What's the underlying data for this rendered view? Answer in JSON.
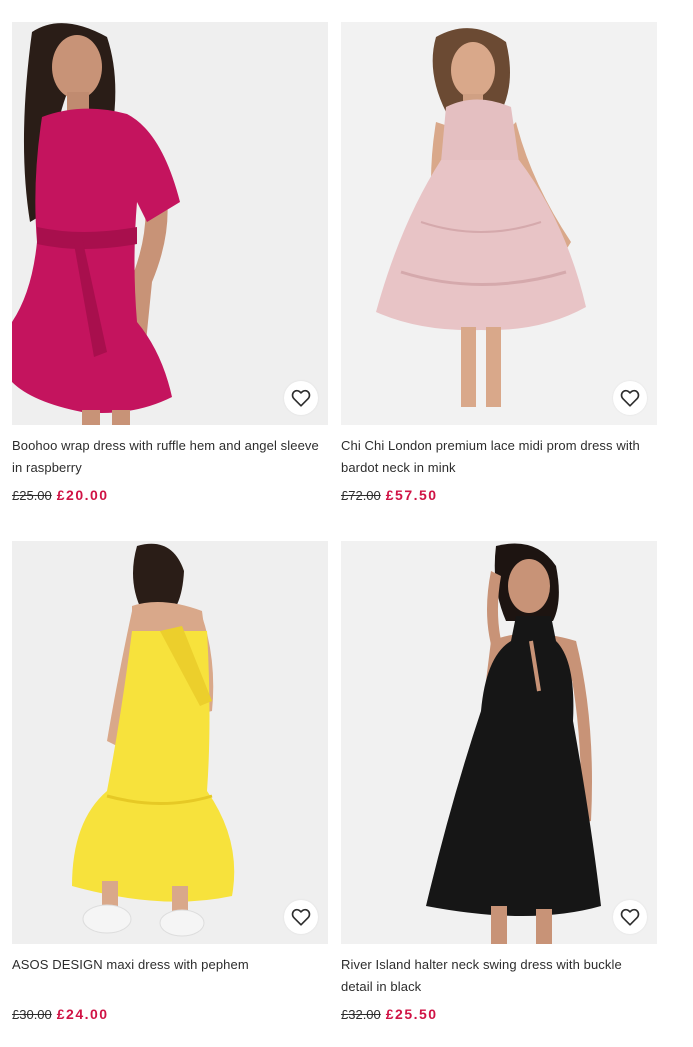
{
  "products": [
    {
      "title": "Boohoo wrap dress with ruffle hem and angel sleeve in raspberry",
      "was_price": "£25.00",
      "now_price": "£20.00",
      "dress_color": "#c4145e",
      "save_icon": "heart-outline-icon"
    },
    {
      "title": "Chi Chi London premium lace midi prom dress with bardot neck in mink",
      "was_price": "£72.00",
      "now_price": "£57.50",
      "dress_color": "#e8c4c6",
      "save_icon": "heart-outline-icon"
    },
    {
      "title": "ASOS DESIGN maxi dress with pephem",
      "was_price": "£30.00",
      "now_price": "£24.00",
      "dress_color": "#f7e23c",
      "save_icon": "heart-outline-icon"
    },
    {
      "title": "River Island halter neck swing dress with buckle detail in black",
      "was_price": "£32.00",
      "now_price": "£25.50",
      "dress_color": "#161616",
      "save_icon": "heart-outline-icon"
    }
  ],
  "colors": {
    "sale_price": "#d01345",
    "text": "#2d2d2d",
    "image_background": "#ececec"
  }
}
